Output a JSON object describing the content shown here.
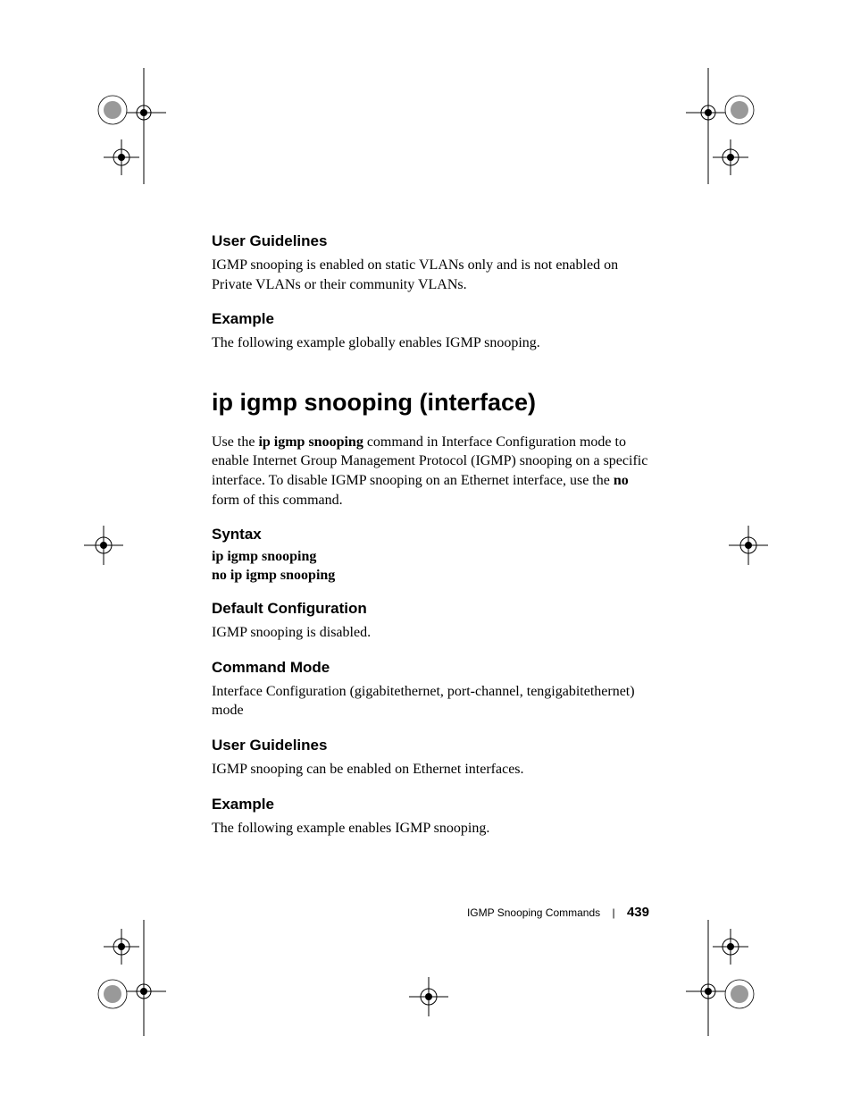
{
  "sections": {
    "s1_heading": "User Guidelines",
    "s1_body": "IGMP snooping is enabled on static VLANs only and is not enabled on Private VLANs or their community VLANs.",
    "s2_heading": "Example",
    "s2_body": "The following example globally enables IGMP snooping.",
    "main_heading": "ip igmp snooping (interface)",
    "intro_pre": "Use the ",
    "intro_cmd": "ip igmp snooping",
    "intro_mid": " command in Interface Configuration mode to enable Internet Group Management Protocol (IGMP) snooping on a specific interface. To disable IGMP snooping on an Ethernet interface, use the ",
    "intro_no": "no",
    "intro_post": " form of this command.",
    "s3_heading": "Syntax",
    "syntax_line1": "ip igmp snooping",
    "syntax_line2": "no ip igmp snooping",
    "s4_heading": "Default Configuration",
    "s4_body": "IGMP snooping is disabled.",
    "s5_heading": "Command Mode",
    "s5_body": "Interface Configuration (gigabitethernet, port-channel, tengigabitethernet) mode",
    "s6_heading": "User Guidelines",
    "s6_body": "IGMP snooping can be enabled on Ethernet interfaces.",
    "s7_heading": "Example",
    "s7_body": "The following example enables IGMP snooping."
  },
  "footer": {
    "section": "IGMP Snooping Commands",
    "page": "439"
  }
}
